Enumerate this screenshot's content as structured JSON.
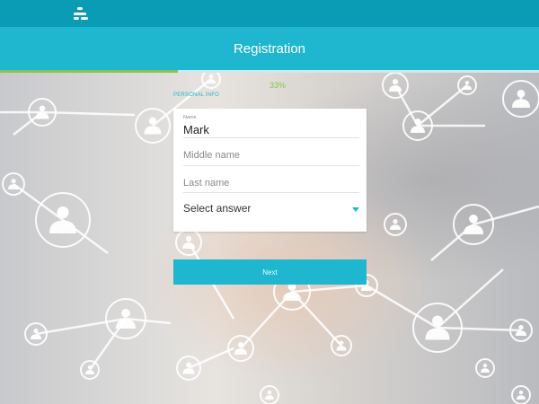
{
  "header": {
    "title": "Registration"
  },
  "progress": {
    "percent_label": "33%",
    "value": 0.33
  },
  "form": {
    "section_label": "PERSONAL INFO",
    "name": {
      "label": "Name",
      "value": "Mark"
    },
    "middle_name": {
      "placeholder": "Middle name"
    },
    "last_name": {
      "placeholder": "Last name"
    },
    "select": {
      "value": "Select answer"
    }
  },
  "actions": {
    "next_label": "Next"
  },
  "icons": {
    "logo": "app-logo-icon",
    "select_caret": "chevron-down-icon"
  },
  "colors": {
    "accent": "#1fb6cf",
    "topbar": "#0a9bb5",
    "progress": "#8bc34a"
  }
}
